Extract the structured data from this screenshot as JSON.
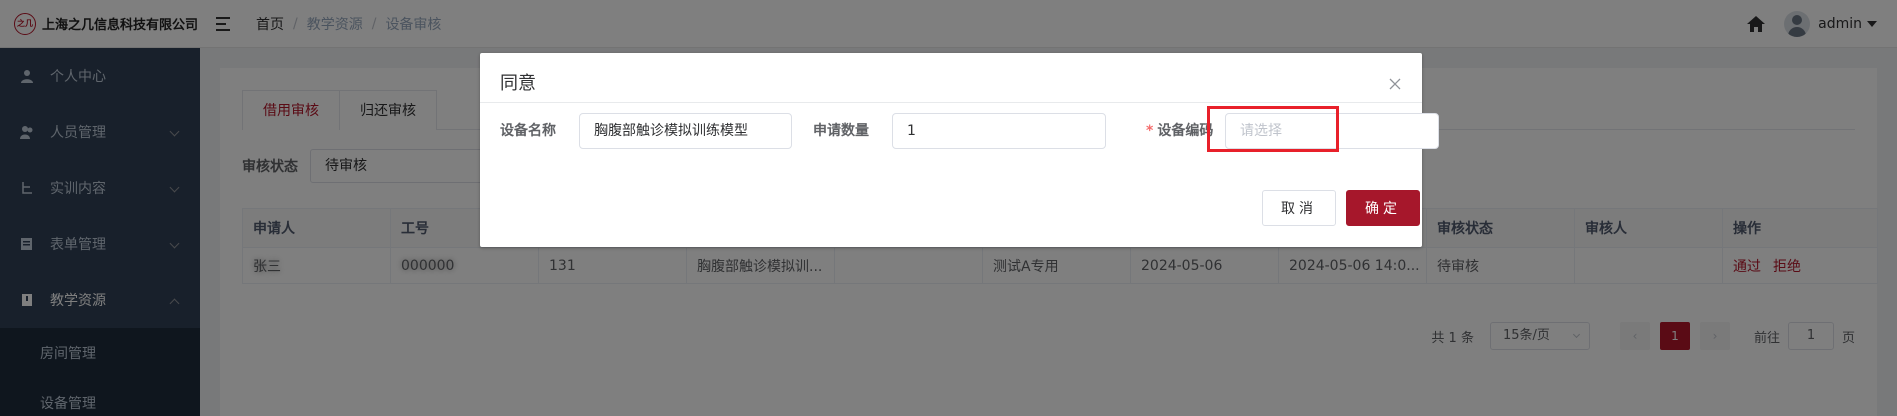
{
  "header": {
    "logo_text": "之几",
    "company": "上海之几信息科技有限公司",
    "breadcrumb": [
      "首页",
      "教学资源",
      "设备审核"
    ],
    "user": "admin",
    "icons": {
      "home": "home-icon",
      "menu": "hamburger-icon",
      "avatar": "user-avatar"
    }
  },
  "sidebar": {
    "items": [
      {
        "label": "个人中心",
        "icon": "user-icon"
      },
      {
        "label": "人员管理",
        "icon": "users-icon"
      },
      {
        "label": "实训内容",
        "icon": "tree-icon"
      },
      {
        "label": "表单管理",
        "icon": "form-icon"
      },
      {
        "label": "教学资源",
        "icon": "book-icon"
      }
    ],
    "sub_items": [
      "房间管理",
      "设备管理"
    ]
  },
  "main": {
    "tabs": [
      "借用审核",
      "归还审核"
    ],
    "filter": {
      "label": "审核状态",
      "value": "待审核"
    },
    "table": {
      "headers": [
        "申请人",
        "工号",
        "",
        "",
        "",
        "",
        "",
        "",
        "审核状态",
        "审核人",
        "操作"
      ],
      "rows": [
        [
          "张三",
          "000000",
          "131",
          "胸腹部触诊模拟训...",
          "",
          "测试A专用",
          "2024-05-06",
          "2024-05-06 14:0...",
          "待审核",
          "",
          ""
        ]
      ],
      "actions": [
        "通过",
        "拒绝"
      ]
    },
    "pagination": {
      "total": "共 1 条",
      "page_size": "15条/页",
      "current": "1",
      "goto_label": "前往",
      "goto_value": "1",
      "page_suffix": "页"
    }
  },
  "dialog": {
    "title": "同意",
    "fields": {
      "device_name_label": "设备名称",
      "device_name_value": "胸腹部触诊模拟训练模型",
      "quantity_label": "申请数量",
      "quantity_value": "1",
      "required_mark": "*",
      "device_code_label": "设备编码",
      "device_code_placeholder": "请选择"
    },
    "cancel": "取消",
    "confirm": "确定"
  },
  "colors": {
    "accent": "#a6172b",
    "sidebar": "#304156"
  }
}
